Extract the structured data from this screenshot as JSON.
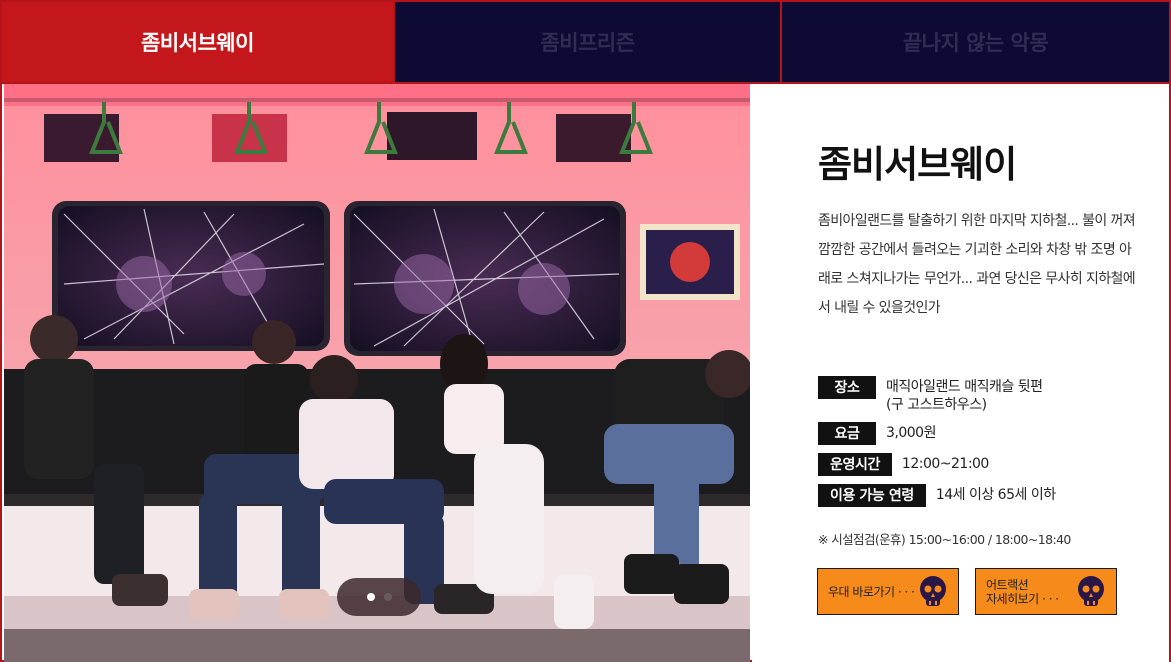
{
  "tabs": [
    {
      "label": "좀비서브웨이",
      "active": true
    },
    {
      "label": "좀비프리즌",
      "active": false
    },
    {
      "label": "끝나지 않는 악몽",
      "active": false
    }
  ],
  "slider": {
    "dots": 2,
    "current": 1
  },
  "attraction": {
    "title": "좀비서브웨이",
    "description": "좀비아일랜드를 탈출하기 위한 마지막 지하철... 불이 꺼져 깜깜한 공간에서 들려오는 기괴한 소리와 차창 밖 조명 아래로 스쳐지나가는 무언가... 과연 당신은 무사히 지하철에서 내릴 수 있을것인가",
    "details": [
      {
        "label": "장소",
        "value": "매직아일랜드 매직캐슬 뒷편\n(구 고스트하우스)"
      },
      {
        "label": "요금",
        "value": "3,000원"
      },
      {
        "label": "운영시간",
        "value": "12:00~21:00"
      },
      {
        "label": "이용 가능 연령",
        "value": "14세 이상 65세 이하"
      }
    ],
    "note": "※ 시설점검(운휴) 15:00~16:00 / 18:00~18:40"
  },
  "buttons": [
    {
      "label": "우대 바로가기 · · ·",
      "icon": "skull-icon"
    },
    {
      "label": "어트랙션\n자세히보기 · · ·",
      "icon": "skull-icon"
    }
  ],
  "colors": {
    "active_tab": "#c4171c",
    "inactive_tab": "#0d0b33",
    "button": "#f68a1a",
    "border": "#b5151a"
  }
}
